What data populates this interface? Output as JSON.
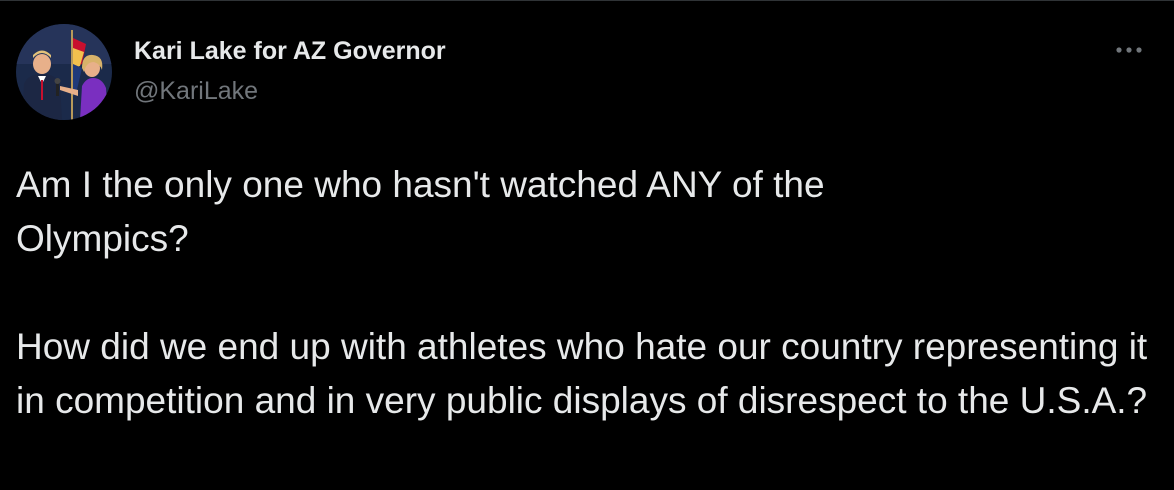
{
  "author": {
    "display_name": "Kari Lake for AZ Governor",
    "handle": "@KariLake",
    "avatar_icon": "profile-photo"
  },
  "menu": {
    "icon": "more-horizontal-icon"
  },
  "tweet": {
    "paragraph_1": "Am I the only one who hasn't watched ANY of the Olympics?",
    "paragraph_2": "How did we end up with athletes who hate our country representing it in competition and in very public displays of disrespect to the U.S.A.?"
  },
  "colors": {
    "background": "#000000",
    "text_primary": "#e7e9ea",
    "text_secondary": "#71767b"
  }
}
